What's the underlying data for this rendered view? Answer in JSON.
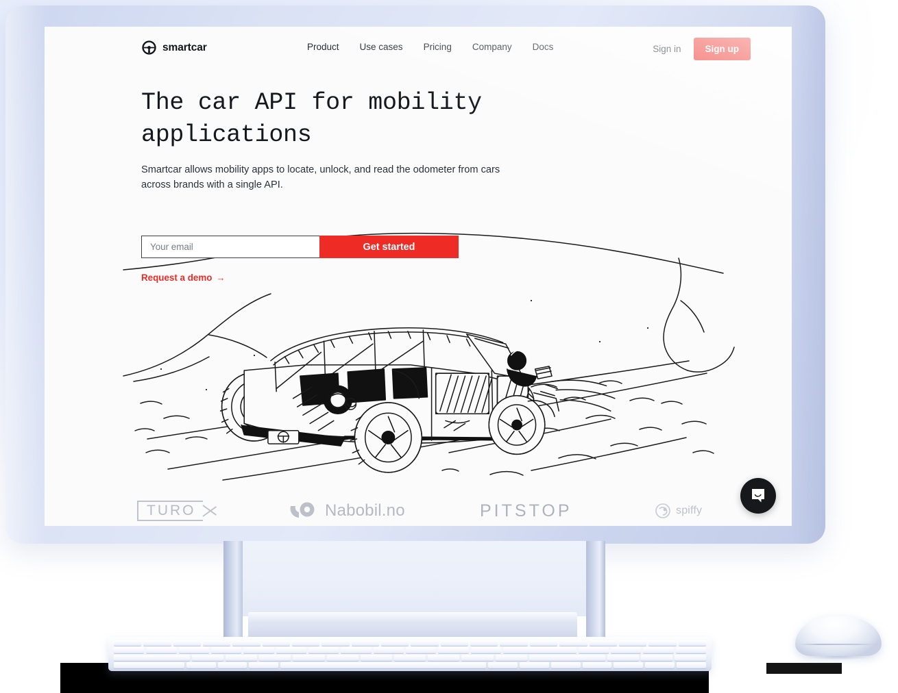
{
  "brand": {
    "name": "smartcar",
    "logo_icon": "steering-wheel-icon"
  },
  "nav": {
    "links": [
      {
        "label": "Product"
      },
      {
        "label": "Use cases"
      },
      {
        "label": "Pricing"
      },
      {
        "label": "Company"
      },
      {
        "label": "Docs"
      }
    ],
    "signin_label": "Sign in",
    "signup_label": "Sign up"
  },
  "hero": {
    "title": "The car API for mobility applications",
    "subtitle": "Smartcar allows mobility apps to locate, unlock, and read the odometer from cars across brands with a single API.",
    "email_placeholder": "Your email",
    "email_value": "",
    "cta_label": "Get started",
    "demo_label": "Request a demo",
    "demo_arrow": "→",
    "illustration_alt": "hand-drawn jeep driving on a desert road"
  },
  "logos": [
    {
      "name": "Turo",
      "text": "TURO"
    },
    {
      "name": "Nabobil",
      "text": "Nabobil.no"
    },
    {
      "name": "Pitstop",
      "text": "PITSTOP"
    },
    {
      "name": "Spiffy",
      "text": "spiffy"
    }
  ],
  "chat": {
    "icon": "chat-bubble-icon",
    "label": "Open chat"
  },
  "colors": {
    "accent_red": "#ee2b24",
    "text_dark": "#15191e",
    "bezel": "#d3dbef",
    "page_bg": "#fbfbfc",
    "logo_gray": "#b5b9c1"
  }
}
